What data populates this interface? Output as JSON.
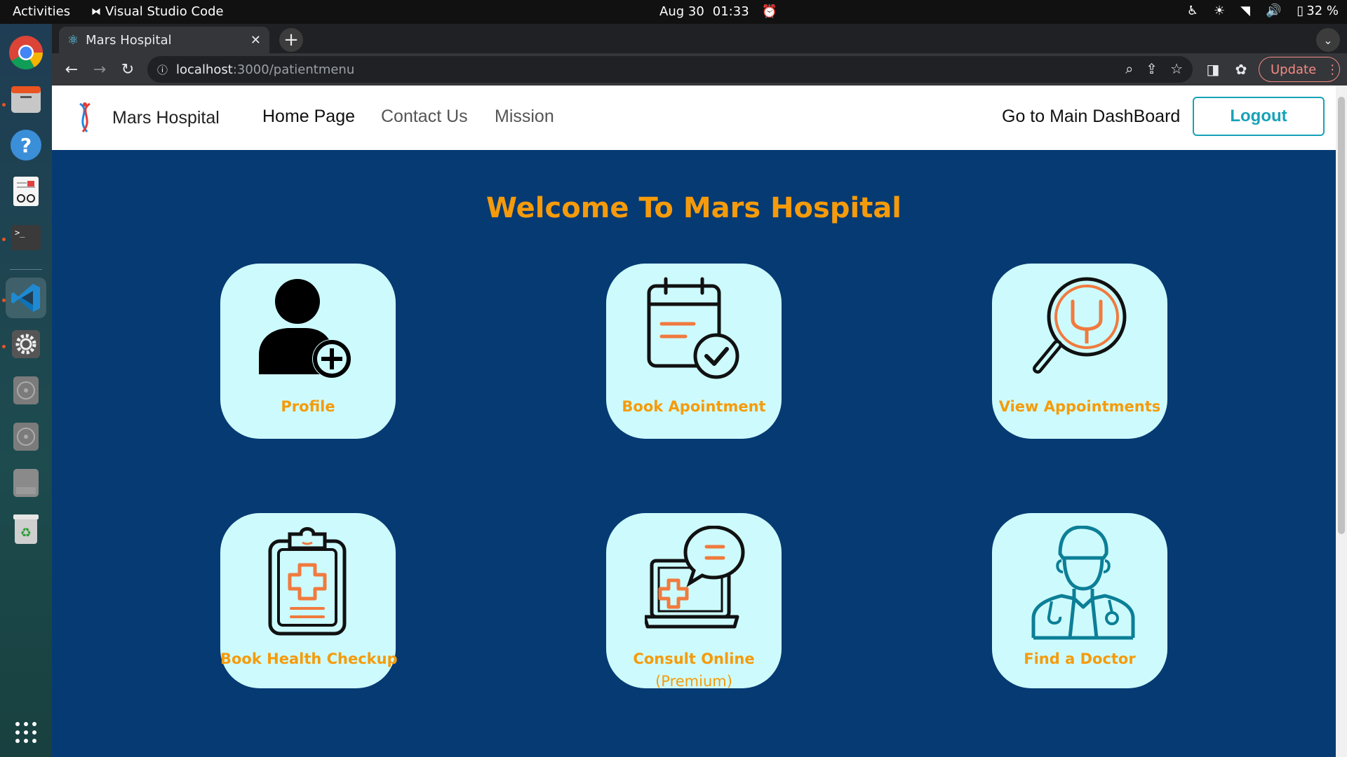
{
  "system_bar": {
    "activities": "Activities",
    "app_name": "Visual Studio Code",
    "date": "Aug 30",
    "time": "01:33",
    "battery": "32 %"
  },
  "browser": {
    "tab_title": "Mars Hospital",
    "url_host": "localhost",
    "url_path": ":3000/patientmenu",
    "update_label": "Update"
  },
  "navbar": {
    "brand": "Mars Hospital",
    "links": [
      "Home Page",
      "Contact Us",
      "Mission"
    ],
    "dashboard": "Go to Main DashBoard",
    "logout": "Logout"
  },
  "page": {
    "welcome": "Welcome To Mars Hospital",
    "cards": [
      {
        "label": "Profile",
        "icon": "user-add-icon"
      },
      {
        "label": "Book Apointment",
        "icon": "calendar-check-icon"
      },
      {
        "label": "View Appointments",
        "icon": "stethoscope-search-icon"
      },
      {
        "label": "Book Health Checkup",
        "icon": "clipboard-medical-icon"
      },
      {
        "label": "Consult Online",
        "sublabel": "(Premium)",
        "icon": "online-consult-icon"
      },
      {
        "label": "Find a Doctor",
        "icon": "doctor-icon"
      }
    ]
  },
  "colors": {
    "page_bg": "#063a73",
    "card_bg": "#cdfbfd",
    "accent": "#f59b0b",
    "logout": "#17a2b8",
    "icon_orange": "#f07a3e",
    "icon_teal": "#0c7f97"
  }
}
